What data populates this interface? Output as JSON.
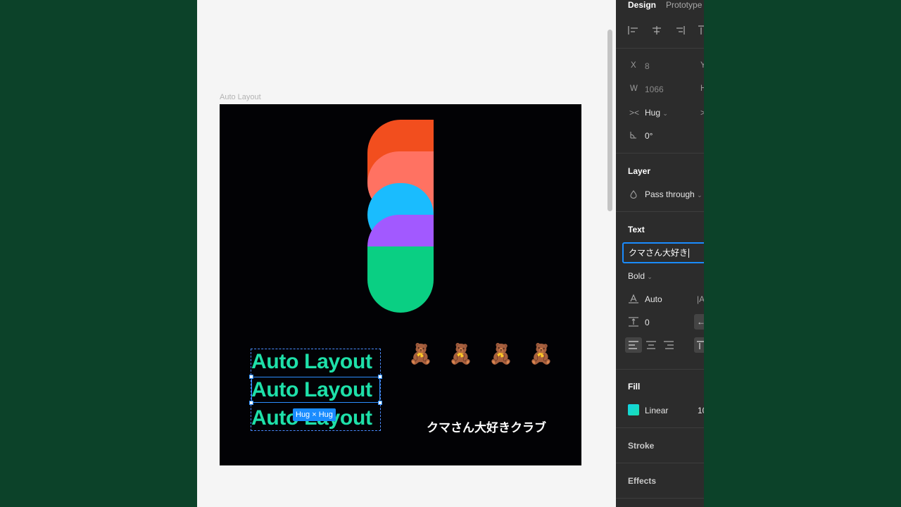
{
  "canvas": {
    "frame_label": "Auto Layout",
    "auto_layout_items": [
      "Auto Layout",
      "Auto Layout",
      "Auto Layout"
    ],
    "hug_badge": "Hug × Hug",
    "bears": [
      "🧸",
      "🧸",
      "🧸",
      "🧸"
    ],
    "caption": "クマさん大好きクラブ"
  },
  "panel": {
    "tabs": {
      "design": "Design",
      "prototype": "Prototype"
    },
    "x_label": "X",
    "x_value": "8",
    "y_label": "Y",
    "w_label": "W",
    "w_value": "1066",
    "h_label": "H",
    "resize_value": "Hug",
    "rotation_value": "0°",
    "layer_title": "Layer",
    "blend_mode": "Pass through",
    "text_title": "Text",
    "text_input_value": "クマさん大好き",
    "font_weight": "Bold",
    "line_height_value": "Auto",
    "paragraph_spacing_value": "0",
    "fill_title": "Fill",
    "fill_type": "Linear",
    "fill_opacity_partial": "10",
    "stroke_title": "Stroke",
    "effects_title": "Effects"
  },
  "colors": {
    "accent": "#1a8cff",
    "logo_orange": "#f24e1e",
    "logo_salmon": "#ff7262",
    "logo_blue": "#1abcfe",
    "logo_purple": "#a259ff",
    "logo_green": "#0acf83",
    "text_gradient": "#1ee0a9"
  }
}
